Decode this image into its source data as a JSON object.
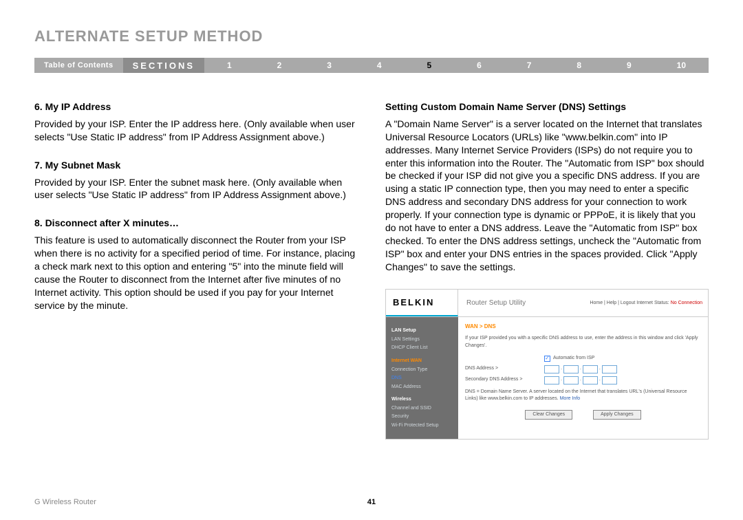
{
  "title": "ALTERNATE SETUP METHOD",
  "nav": {
    "toc": "Table of Contents",
    "sections": "SECTIONS",
    "nums": [
      "1",
      "2",
      "3",
      "4",
      "5",
      "6",
      "7",
      "8",
      "9",
      "10"
    ],
    "active": "5"
  },
  "left": {
    "h6": "6.   My IP Address",
    "p6": "Provided by your ISP. Enter the IP address here. (Only available when user selects \"Use Static IP address\" from IP Address Assignment above.)",
    "h7": "7.   My Subnet Mask",
    "p7": "Provided by your ISP. Enter the subnet mask here. (Only available when user selects \"Use Static IP address\" from IP Address Assignment above.)",
    "h8": "8.   Disconnect after X minutes…",
    "p8": "This feature is used to automatically disconnect the Router from your ISP when there is no activity for a specified period of time. For instance, placing a check mark next to this option and entering \"5\" into the minute field will cause the Router to disconnect from the Internet after five minutes of no Internet activity. This option should be used if you pay for your Internet service by the minute."
  },
  "right": {
    "h": "Setting Custom Domain Name Server (DNS) Settings",
    "p": "A \"Domain Name Server\" is a server located on the Internet that translates Universal Resource Locators (URLs) like \"www.belkin.com\" into IP addresses. Many Internet Service Providers (ISPs) do not require you to enter this information into the Router. The \"Automatic from ISP\" box should be checked if your ISP did not give you a specific DNS address. If you are using a static IP connection type, then you may need to enter a specific DNS address and secondary DNS address for your connection to work properly. If your connection type is dynamic or PPPoE, it is likely that you do not have to enter a DNS address. Leave the \"Automatic from ISP\" box checked. To enter the DNS address settings, uncheck the \"Automatic from ISP\" box and enter your DNS entries in the spaces provided. Click \"Apply Changes\" to save the settings."
  },
  "utility": {
    "logo": "BELKIN",
    "appTitle": "Router Setup Utility",
    "links": "Home | Help | Logout   Internet Status: ",
    "status": "No Connection",
    "sidebar": {
      "g1": "LAN Setup",
      "g1a": "LAN Settings",
      "g1b": "DHCP Client List",
      "g2": "Internet WAN",
      "g2a": "Connection Type",
      "g2b": "DNS",
      "g2c": "MAC Address",
      "g3": "Wireless",
      "g3a": "Channel and SSID",
      "g3b": "Security",
      "g3c": "Wi-Fi Protected Setup"
    },
    "content": {
      "crumb": "WAN > DNS",
      "intro": "If your ISP provided you with a specific DNS address to use, enter the address in this window and click 'Apply Changes'.",
      "auto": "Automatic from ISP",
      "dns": "DNS Address >",
      "dns2": "Secondary DNS Address >",
      "note": "DNS = Domain Name Server. A server located on the Internet that translates URL's (Universal Resource Links) like www.belkin.com to IP addresses. ",
      "more": "More Info",
      "clear": "Clear Changes",
      "apply": "Apply Changes"
    }
  },
  "footer": {
    "product": "G Wireless Router",
    "page": "41"
  }
}
